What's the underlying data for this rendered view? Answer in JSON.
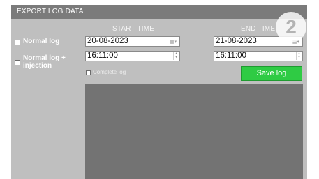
{
  "window": {
    "title": "EXPORT LOG DATA"
  },
  "columns": {
    "start": "START TIME",
    "end": "END TIME"
  },
  "options": {
    "normal_log": "Normal log",
    "normal_log_injection_line1": "Normal log +",
    "normal_log_injection_line2": "injection",
    "complete_log": "Complete log"
  },
  "start": {
    "date": "20-08-2023",
    "time": "16:11:00"
  },
  "end": {
    "date": "21-08-2023",
    "time": "16:11:00"
  },
  "buttons": {
    "save": "Save log"
  },
  "step_badge": "2",
  "icons": {
    "calendar": "calendar-icon",
    "spinner": "spinner-icon"
  },
  "colors": {
    "save_button": "#2fcb44",
    "titlebar": "#7b7b7b",
    "panel": "#bfbfbf"
  }
}
